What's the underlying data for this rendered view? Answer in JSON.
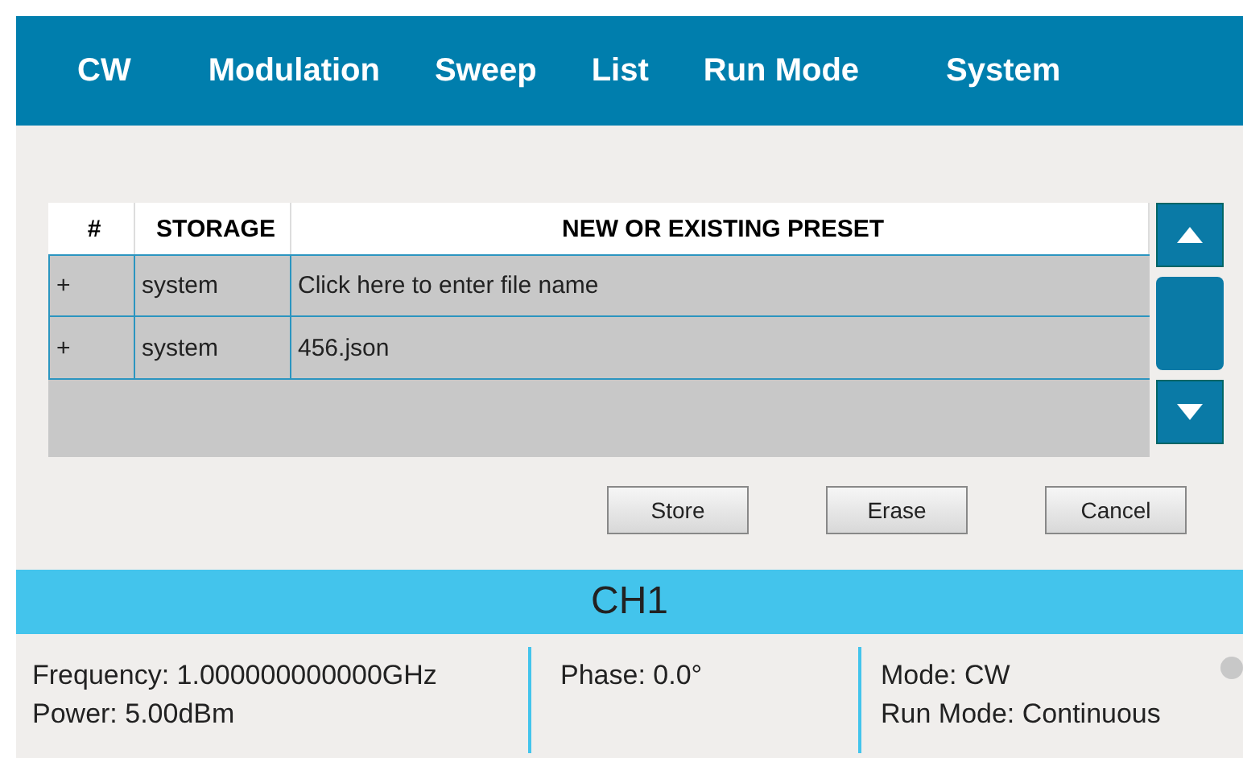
{
  "nav_tabs": [
    {
      "label": "CW"
    },
    {
      "label": "Modulation"
    },
    {
      "label": "Sweep"
    },
    {
      "label": "List"
    },
    {
      "label": "Run Mode"
    },
    {
      "label": "System"
    }
  ],
  "table": {
    "columns": [
      "#",
      "STORAGE",
      "NEW OR EXISTING PRESET"
    ],
    "rows": [
      {
        "cells": [
          "+",
          "system",
          "Click here to enter file name"
        ]
      },
      {
        "cells": [
          "+",
          "system",
          "456.json"
        ]
      }
    ]
  },
  "buttons": [
    "Store",
    "Erase",
    "Cancel"
  ],
  "channel": {
    "title": "CH1",
    "columns": [
      [
        "Frequency: 1.000000000000GHz",
        "Power: 5.00dBm"
      ],
      [
        "Phase: 0.0°"
      ],
      [
        "Mode: CW",
        "Run Mode: Continuous"
      ]
    ]
  }
}
